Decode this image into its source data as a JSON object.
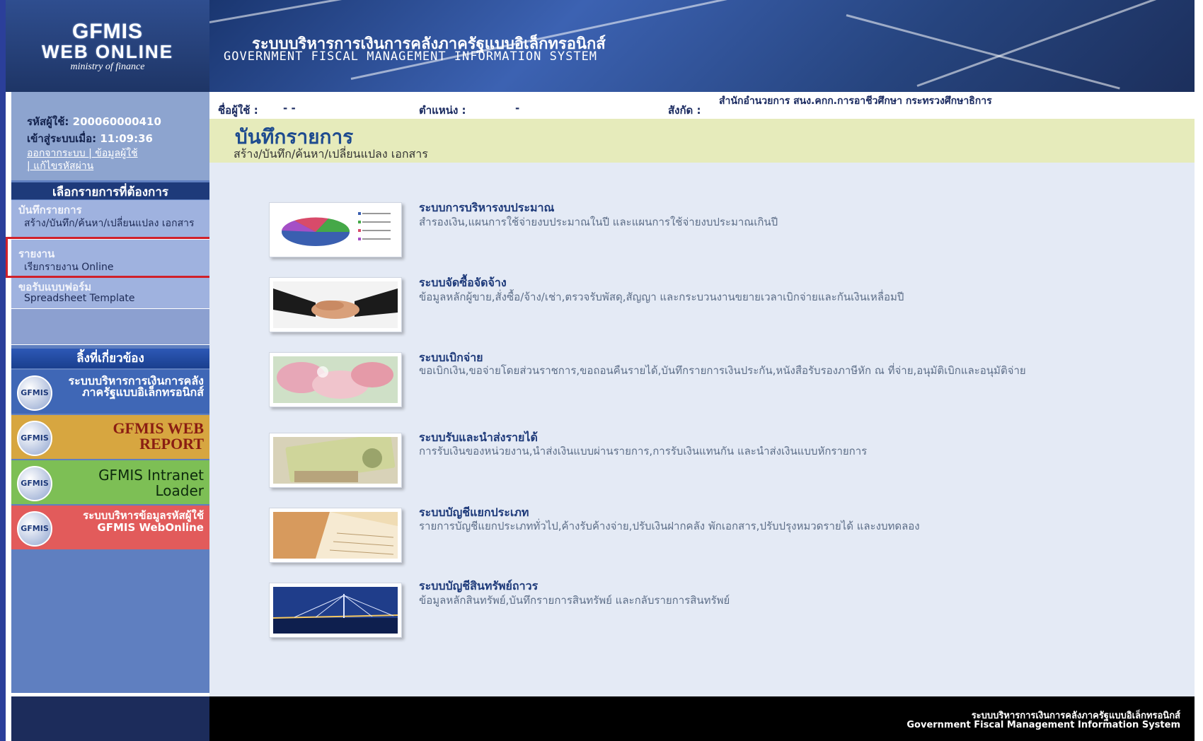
{
  "logo": {
    "line1": "GFMIS",
    "line2": "WEB ONLINE",
    "line3": "ministry of finance"
  },
  "banner": {
    "title_th": "ระบบบริหารการเงินการคลังภาครัฐแบบอิเล็กทรอนิกส์",
    "title_en": "GOVERNMENT FISCAL MANAGEMENT INFORMATION SYSTEM"
  },
  "user": {
    "id_label": "รหัสผู้ใช้:",
    "id_value": "200060000410",
    "login_label": "เข้าสู่ระบบเมื่อ:",
    "login_value": "11:09:36",
    "links_line1": "ออกจากระบบ | ข้อมูลผู้ใช้",
    "links_line2": "| แก้ไขรหัสผ่าน"
  },
  "menu": {
    "header": "เลือกรายการที่ต้องการ",
    "items": [
      {
        "title": "บันทึกรายการ",
        "sub": "สร้าง/บันทึก/ค้นหา/เปลี่ยนแปลง เอกสาร"
      },
      {
        "title": "รายงาน",
        "sub": "เรียกรายงาน Online"
      },
      {
        "title": "ขอรับแบบฟอร์ม",
        "sub": "Spreadsheet Template"
      }
    ]
  },
  "related": {
    "header": "ลิ้งที่เกี่ยวข้อง",
    "buttons": [
      {
        "badge": "GFMIS",
        "text": "ระบบบริหารการเงินการคลังภาครัฐแบบอิเล็กทรอนิกส์",
        "bg": "#3f67b6",
        "fg": "#ffffff"
      },
      {
        "badge": "GFMIS",
        "text": "GFMIS WEB REPORT",
        "bg": "#d7a640",
        "fg": "#8a1d12"
      },
      {
        "badge": "GFMIS",
        "text": "GFMIS Intranet Loader",
        "bg": "#7dbf55",
        "fg": "#0d2a0d"
      },
      {
        "badge": "GFMIS",
        "text": "ระบบบริหารข้อมูลรหัสผู้ใช้ GFMIS WebOnline",
        "bg": "#e25b5b",
        "fg": "#ffffff"
      }
    ]
  },
  "userbar": {
    "name_label": "ชื่อผู้ใช้ :",
    "name_value": "- -",
    "position_label": "ตำแหน่ง :",
    "position_value": "-",
    "affil_label": "สังกัด :",
    "affil_value": "สำนักอำนวยการ สนง.คกก.การอาชีวศึกษา กระทรวงศึกษาธิการ"
  },
  "page": {
    "title": "บันทึกรายการ",
    "subtitle": "สร้าง/บันทึก/ค้นหา/เปลี่ยนแปลง เอกสาร"
  },
  "systems": [
    {
      "icon": "pie-chart-icon",
      "title": "ระบบการบริหารงบประมาณ",
      "desc": "สำรองเงิน,แผนการใช้จ่ายงบประมาณในปี และแผนการใช้จ่ายงบประมาณเกินปี"
    },
    {
      "icon": "handshake-icon",
      "title": "ระบบจัดซื้อจัดจ้าง",
      "desc": "ข้อมูลหลักผู้ขาย,สั่งซื้อ/จ้าง/เช่า,ตรวจรับพัสดุ,สัญญา และกระบวนงานขยายเวลาเบิกจ่ายและกันเงินเหลื่อมปี"
    },
    {
      "icon": "money-icon",
      "title": "ระบบเบิกจ่าย",
      "desc": "ขอเบิกเงิน,ขอจ่ายโดยส่วนราชการ,ขอถอนคืนรายได้,บันทึกรายการเงินประกัน,หนังสือรับรองภาษีหัก ณ ที่จ่าย,อนุมัติเบิกและอนุมัติจ่าย"
    },
    {
      "icon": "banknote-icon",
      "title": "ระบบรับและนำส่งรายได้",
      "desc": "การรับเงินของหน่วยงาน,นำส่งเงินแบบผ่านรายการ,การรับเงินแทนกัน และนำส่งเงินแบบหักรายการ"
    },
    {
      "icon": "ledger-icon",
      "title": "ระบบบัญชีแยกประเภท",
      "desc": "รายการบัญชีแยกประเภททั่วไป,ค้างรับค้างจ่าย,ปรับเงินฝากคลัง พักเอกสาร,ปรับปรุงหมวดรายได้ และงบทดลอง"
    },
    {
      "icon": "bridge-icon",
      "title": "ระบบบัญชีสินทรัพย์ถาวร",
      "desc": "ข้อมูลหลักสินทรัพย์,บันทึกรายการสินทรัพย์ และกลับรายการสินทรัพย์"
    }
  ],
  "footer": {
    "line1": "ระบบบริหารการเงินการคลังภาครัฐแบบอิเล็กทรอนิกส์",
    "line2": "Government Fiscal Management Information System"
  },
  "colors": {
    "highlight": "#d0202a",
    "title_band": "#e6ebbb",
    "main_bg": "#e4eaf5",
    "sidebar": "#5f7fc0"
  }
}
